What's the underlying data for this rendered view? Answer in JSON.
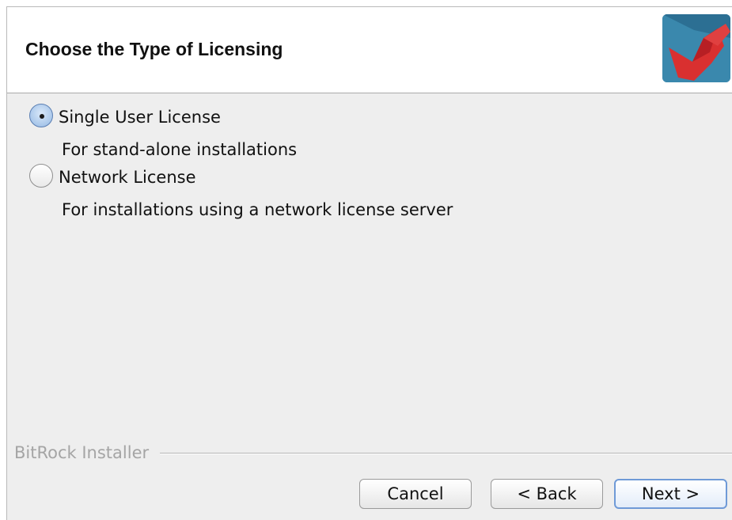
{
  "header": {
    "title": "Choose the Type of Licensing",
    "logo_icon": "bitrock-logo-icon"
  },
  "options": [
    {
      "label": "Single User License",
      "description": "For stand-alone installations",
      "selected": true
    },
    {
      "label": "Network License",
      "description": "For installations using a network license server",
      "selected": false
    }
  ],
  "footer": {
    "brand": "BitRock Installer"
  },
  "buttons": {
    "cancel": "Cancel",
    "back": "< Back",
    "next": "Next >"
  },
  "colors": {
    "accent": "#6f9ad7",
    "logo_red": "#d62e2e",
    "logo_blue": "#3d8fb2"
  }
}
